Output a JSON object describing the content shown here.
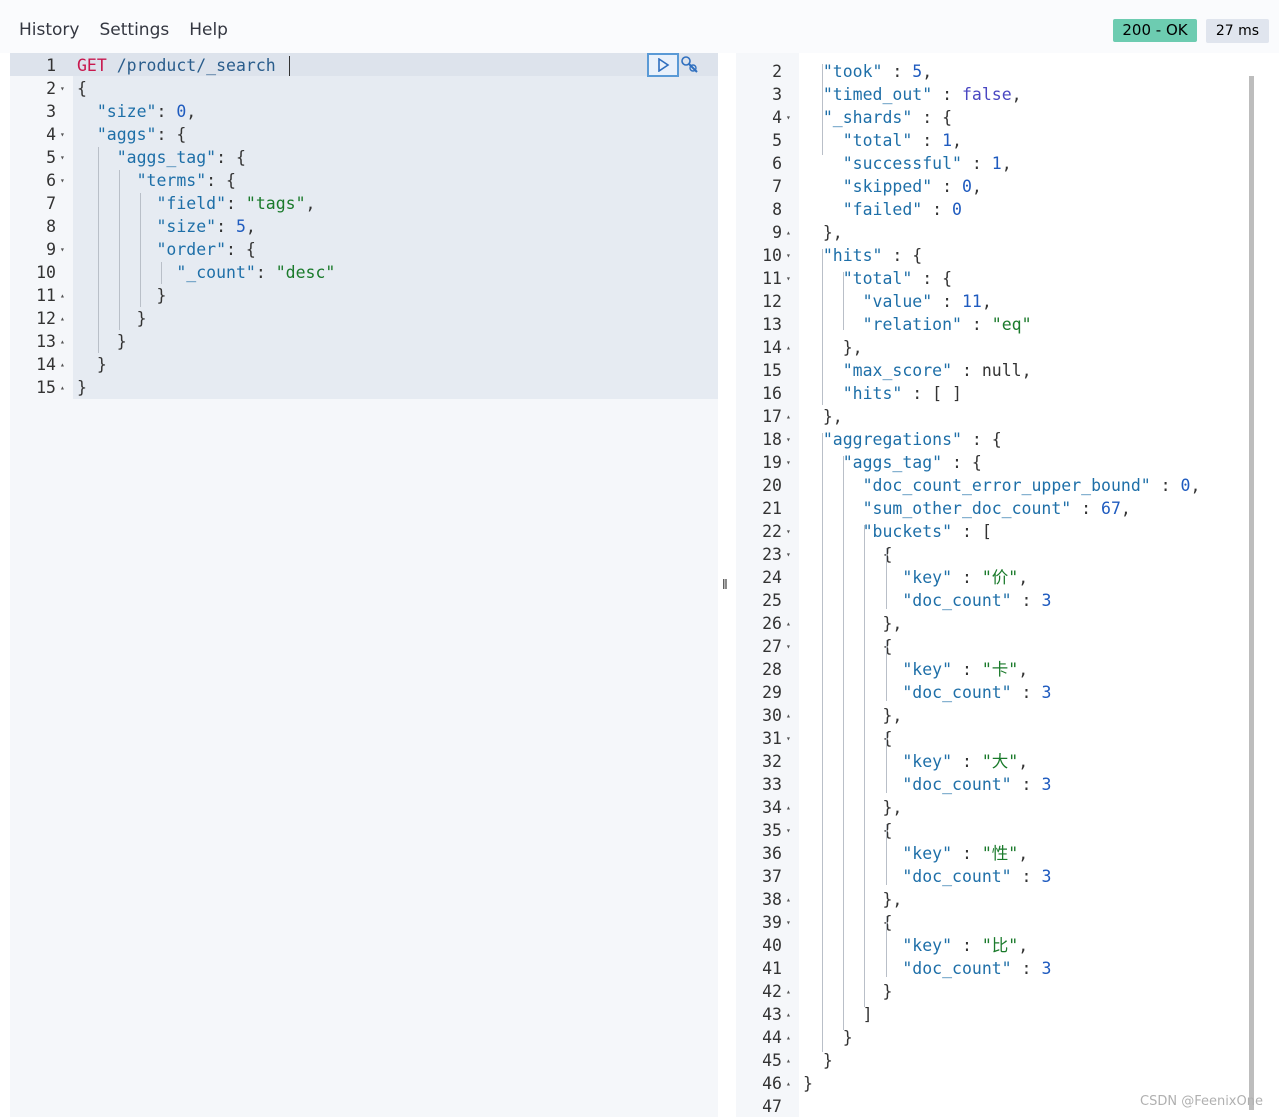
{
  "menu": {
    "history": "History",
    "settings": "Settings",
    "help": "Help"
  },
  "status": {
    "code": "200 - OK",
    "time": "27 ms"
  },
  "watermark": "CSDN @FeenixOne",
  "request": {
    "method": "GET",
    "path": "/product/_search",
    "lines": [
      {
        "n": "1",
        "fold": ""
      },
      {
        "n": "2",
        "fold": "▾"
      },
      {
        "n": "3",
        "fold": ""
      },
      {
        "n": "4",
        "fold": "▾"
      },
      {
        "n": "5",
        "fold": "▾"
      },
      {
        "n": "6",
        "fold": "▾"
      },
      {
        "n": "7",
        "fold": ""
      },
      {
        "n": "8",
        "fold": ""
      },
      {
        "n": "9",
        "fold": "▾"
      },
      {
        "n": "10",
        "fold": ""
      },
      {
        "n": "11",
        "fold": "▴"
      },
      {
        "n": "12",
        "fold": "▴"
      },
      {
        "n": "13",
        "fold": "▴"
      },
      {
        "n": "14",
        "fold": "▴"
      },
      {
        "n": "15",
        "fold": "▴"
      }
    ],
    "code": [
      [
        {
          "t": "GET",
          "c": "m"
        },
        {
          "t": " ",
          "c": "p"
        },
        {
          "t": "/product/_search",
          "c": "u"
        }
      ],
      [
        {
          "t": "{",
          "c": "p"
        }
      ],
      [
        {
          "t": "  ",
          "c": "p"
        },
        {
          "t": "\"size\"",
          "c": "k"
        },
        {
          "t": ": ",
          "c": "p"
        },
        {
          "t": "0",
          "c": "n"
        },
        {
          "t": ",",
          "c": "p"
        }
      ],
      [
        {
          "t": "  ",
          "c": "p"
        },
        {
          "t": "\"aggs\"",
          "c": "k"
        },
        {
          "t": ": {",
          "c": "p"
        }
      ],
      [
        {
          "t": "    ",
          "c": "p"
        },
        {
          "t": "\"aggs_tag\"",
          "c": "k"
        },
        {
          "t": ": {",
          "c": "p"
        }
      ],
      [
        {
          "t": "      ",
          "c": "p"
        },
        {
          "t": "\"terms\"",
          "c": "k"
        },
        {
          "t": ": {",
          "c": "p"
        }
      ],
      [
        {
          "t": "        ",
          "c": "p"
        },
        {
          "t": "\"field\"",
          "c": "k"
        },
        {
          "t": ": ",
          "c": "p"
        },
        {
          "t": "\"tags\"",
          "c": "s"
        },
        {
          "t": ",",
          "c": "p"
        }
      ],
      [
        {
          "t": "        ",
          "c": "p"
        },
        {
          "t": "\"size\"",
          "c": "k"
        },
        {
          "t": ": ",
          "c": "p"
        },
        {
          "t": "5",
          "c": "n"
        },
        {
          "t": ",",
          "c": "p"
        }
      ],
      [
        {
          "t": "        ",
          "c": "p"
        },
        {
          "t": "\"order\"",
          "c": "k"
        },
        {
          "t": ": {",
          "c": "p"
        }
      ],
      [
        {
          "t": "          ",
          "c": "p"
        },
        {
          "t": "\"_count\"",
          "c": "k"
        },
        {
          "t": ": ",
          "c": "p"
        },
        {
          "t": "\"desc\"",
          "c": "s"
        }
      ],
      [
        {
          "t": "        }",
          "c": "p"
        }
      ],
      [
        {
          "t": "      }",
          "c": "p"
        }
      ],
      [
        {
          "t": "    }",
          "c": "p"
        }
      ],
      [
        {
          "t": "  }",
          "c": "p"
        }
      ],
      [
        {
          "t": "}",
          "c": "p"
        }
      ]
    ]
  },
  "response": {
    "lines": [
      {
        "n": "2",
        "fold": ""
      },
      {
        "n": "3",
        "fold": ""
      },
      {
        "n": "4",
        "fold": "▾"
      },
      {
        "n": "5",
        "fold": ""
      },
      {
        "n": "6",
        "fold": ""
      },
      {
        "n": "7",
        "fold": ""
      },
      {
        "n": "8",
        "fold": ""
      },
      {
        "n": "9",
        "fold": "▴"
      },
      {
        "n": "10",
        "fold": "▾"
      },
      {
        "n": "11",
        "fold": "▾"
      },
      {
        "n": "12",
        "fold": ""
      },
      {
        "n": "13",
        "fold": ""
      },
      {
        "n": "14",
        "fold": "▴"
      },
      {
        "n": "15",
        "fold": ""
      },
      {
        "n": "16",
        "fold": ""
      },
      {
        "n": "17",
        "fold": "▴"
      },
      {
        "n": "18",
        "fold": "▾"
      },
      {
        "n": "19",
        "fold": "▾"
      },
      {
        "n": "20",
        "fold": ""
      },
      {
        "n": "21",
        "fold": ""
      },
      {
        "n": "22",
        "fold": "▾"
      },
      {
        "n": "23",
        "fold": "▾"
      },
      {
        "n": "24",
        "fold": ""
      },
      {
        "n": "25",
        "fold": ""
      },
      {
        "n": "26",
        "fold": "▴"
      },
      {
        "n": "27",
        "fold": "▾"
      },
      {
        "n": "28",
        "fold": ""
      },
      {
        "n": "29",
        "fold": ""
      },
      {
        "n": "30",
        "fold": "▴"
      },
      {
        "n": "31",
        "fold": "▾"
      },
      {
        "n": "32",
        "fold": ""
      },
      {
        "n": "33",
        "fold": ""
      },
      {
        "n": "34",
        "fold": "▴"
      },
      {
        "n": "35",
        "fold": "▾"
      },
      {
        "n": "36",
        "fold": ""
      },
      {
        "n": "37",
        "fold": ""
      },
      {
        "n": "38",
        "fold": "▴"
      },
      {
        "n": "39",
        "fold": "▾"
      },
      {
        "n": "40",
        "fold": ""
      },
      {
        "n": "41",
        "fold": ""
      },
      {
        "n": "42",
        "fold": "▴"
      },
      {
        "n": "43",
        "fold": "▴"
      },
      {
        "n": "44",
        "fold": "▴"
      },
      {
        "n": "45",
        "fold": "▴"
      },
      {
        "n": "46",
        "fold": "▴"
      },
      {
        "n": "47",
        "fold": ""
      }
    ],
    "code": [
      [
        {
          "t": "  ",
          "c": "p"
        },
        {
          "t": "\"took\"",
          "c": "k"
        },
        {
          "t": " : ",
          "c": "p"
        },
        {
          "t": "5",
          "c": "n"
        },
        {
          "t": ",",
          "c": "p"
        }
      ],
      [
        {
          "t": "  ",
          "c": "p"
        },
        {
          "t": "\"timed_out\"",
          "c": "k"
        },
        {
          "t": " : ",
          "c": "p"
        },
        {
          "t": "false",
          "c": "b"
        },
        {
          "t": ",",
          "c": "p"
        }
      ],
      [
        {
          "t": "  ",
          "c": "p"
        },
        {
          "t": "\"_shards\"",
          "c": "k"
        },
        {
          "t": " : {",
          "c": "p"
        }
      ],
      [
        {
          "t": "    ",
          "c": "p"
        },
        {
          "t": "\"total\"",
          "c": "k"
        },
        {
          "t": " : ",
          "c": "p"
        },
        {
          "t": "1",
          "c": "n"
        },
        {
          "t": ",",
          "c": "p"
        }
      ],
      [
        {
          "t": "    ",
          "c": "p"
        },
        {
          "t": "\"successful\"",
          "c": "k"
        },
        {
          "t": " : ",
          "c": "p"
        },
        {
          "t": "1",
          "c": "n"
        },
        {
          "t": ",",
          "c": "p"
        }
      ],
      [
        {
          "t": "    ",
          "c": "p"
        },
        {
          "t": "\"skipped\"",
          "c": "k"
        },
        {
          "t": " : ",
          "c": "p"
        },
        {
          "t": "0",
          "c": "n"
        },
        {
          "t": ",",
          "c": "p"
        }
      ],
      [
        {
          "t": "    ",
          "c": "p"
        },
        {
          "t": "\"failed\"",
          "c": "k"
        },
        {
          "t": " : ",
          "c": "p"
        },
        {
          "t": "0",
          "c": "n"
        }
      ],
      [
        {
          "t": "  },",
          "c": "p"
        }
      ],
      [
        {
          "t": "  ",
          "c": "p"
        },
        {
          "t": "\"hits\"",
          "c": "k"
        },
        {
          "t": " : {",
          "c": "p"
        }
      ],
      [
        {
          "t": "    ",
          "c": "p"
        },
        {
          "t": "\"total\"",
          "c": "k"
        },
        {
          "t": " : {",
          "c": "p"
        }
      ],
      [
        {
          "t": "      ",
          "c": "p"
        },
        {
          "t": "\"value\"",
          "c": "k"
        },
        {
          "t": " : ",
          "c": "p"
        },
        {
          "t": "11",
          "c": "n"
        },
        {
          "t": ",",
          "c": "p"
        }
      ],
      [
        {
          "t": "      ",
          "c": "p"
        },
        {
          "t": "\"relation\"",
          "c": "k"
        },
        {
          "t": " : ",
          "c": "p"
        },
        {
          "t": "\"eq\"",
          "c": "s"
        }
      ],
      [
        {
          "t": "    },",
          "c": "p"
        }
      ],
      [
        {
          "t": "    ",
          "c": "p"
        },
        {
          "t": "\"max_score\"",
          "c": "k"
        },
        {
          "t": " : null,",
          "c": "p"
        }
      ],
      [
        {
          "t": "    ",
          "c": "p"
        },
        {
          "t": "\"hits\"",
          "c": "k"
        },
        {
          "t": " : [ ]",
          "c": "p"
        }
      ],
      [
        {
          "t": "  },",
          "c": "p"
        }
      ],
      [
        {
          "t": "  ",
          "c": "p"
        },
        {
          "t": "\"aggregations\"",
          "c": "k"
        },
        {
          "t": " : {",
          "c": "p"
        }
      ],
      [
        {
          "t": "    ",
          "c": "p"
        },
        {
          "t": "\"aggs_tag\"",
          "c": "k"
        },
        {
          "t": " : {",
          "c": "p"
        }
      ],
      [
        {
          "t": "      ",
          "c": "p"
        },
        {
          "t": "\"doc_count_error_upper_bound\"",
          "c": "k"
        },
        {
          "t": " : ",
          "c": "p"
        },
        {
          "t": "0",
          "c": "n"
        },
        {
          "t": ",",
          "c": "p"
        }
      ],
      [
        {
          "t": "      ",
          "c": "p"
        },
        {
          "t": "\"sum_other_doc_count\"",
          "c": "k"
        },
        {
          "t": " : ",
          "c": "p"
        },
        {
          "t": "67",
          "c": "n"
        },
        {
          "t": ",",
          "c": "p"
        }
      ],
      [
        {
          "t": "      ",
          "c": "p"
        },
        {
          "t": "\"buckets\"",
          "c": "k"
        },
        {
          "t": " : [",
          "c": "p"
        }
      ],
      [
        {
          "t": "        {",
          "c": "p"
        }
      ],
      [
        {
          "t": "          ",
          "c": "p"
        },
        {
          "t": "\"key\"",
          "c": "k"
        },
        {
          "t": " : ",
          "c": "p"
        },
        {
          "t": "\"价\"",
          "c": "s"
        },
        {
          "t": ",",
          "c": "p"
        }
      ],
      [
        {
          "t": "          ",
          "c": "p"
        },
        {
          "t": "\"doc_count\"",
          "c": "k"
        },
        {
          "t": " : ",
          "c": "p"
        },
        {
          "t": "3",
          "c": "n"
        }
      ],
      [
        {
          "t": "        },",
          "c": "p"
        }
      ],
      [
        {
          "t": "        {",
          "c": "p"
        }
      ],
      [
        {
          "t": "          ",
          "c": "p"
        },
        {
          "t": "\"key\"",
          "c": "k"
        },
        {
          "t": " : ",
          "c": "p"
        },
        {
          "t": "\"卡\"",
          "c": "s"
        },
        {
          "t": ",",
          "c": "p"
        }
      ],
      [
        {
          "t": "          ",
          "c": "p"
        },
        {
          "t": "\"doc_count\"",
          "c": "k"
        },
        {
          "t": " : ",
          "c": "p"
        },
        {
          "t": "3",
          "c": "n"
        }
      ],
      [
        {
          "t": "        },",
          "c": "p"
        }
      ],
      [
        {
          "t": "        {",
          "c": "p"
        }
      ],
      [
        {
          "t": "          ",
          "c": "p"
        },
        {
          "t": "\"key\"",
          "c": "k"
        },
        {
          "t": " : ",
          "c": "p"
        },
        {
          "t": "\"大\"",
          "c": "s"
        },
        {
          "t": ",",
          "c": "p"
        }
      ],
      [
        {
          "t": "          ",
          "c": "p"
        },
        {
          "t": "\"doc_count\"",
          "c": "k"
        },
        {
          "t": " : ",
          "c": "p"
        },
        {
          "t": "3",
          "c": "n"
        }
      ],
      [
        {
          "t": "        },",
          "c": "p"
        }
      ],
      [
        {
          "t": "        {",
          "c": "p"
        }
      ],
      [
        {
          "t": "          ",
          "c": "p"
        },
        {
          "t": "\"key\"",
          "c": "k"
        },
        {
          "t": " : ",
          "c": "p"
        },
        {
          "t": "\"性\"",
          "c": "s"
        },
        {
          "t": ",",
          "c": "p"
        }
      ],
      [
        {
          "t": "          ",
          "c": "p"
        },
        {
          "t": "\"doc_count\"",
          "c": "k"
        },
        {
          "t": " : ",
          "c": "p"
        },
        {
          "t": "3",
          "c": "n"
        }
      ],
      [
        {
          "t": "        },",
          "c": "p"
        }
      ],
      [
        {
          "t": "        {",
          "c": "p"
        }
      ],
      [
        {
          "t": "          ",
          "c": "p"
        },
        {
          "t": "\"key\"",
          "c": "k"
        },
        {
          "t": " : ",
          "c": "p"
        },
        {
          "t": "\"比\"",
          "c": "s"
        },
        {
          "t": ",",
          "c": "p"
        }
      ],
      [
        {
          "t": "          ",
          "c": "p"
        },
        {
          "t": "\"doc_count\"",
          "c": "k"
        },
        {
          "t": " : ",
          "c": "p"
        },
        {
          "t": "3",
          "c": "n"
        }
      ],
      [
        {
          "t": "        }",
          "c": "p"
        }
      ],
      [
        {
          "t": "      ]",
          "c": "p"
        }
      ],
      [
        {
          "t": "    }",
          "c": "p"
        }
      ],
      [
        {
          "t": "  }",
          "c": "p"
        }
      ],
      [
        {
          "t": "}",
          "c": "p"
        }
      ],
      [
        {
          "t": "",
          "c": "p"
        }
      ]
    ]
  },
  "icons": {
    "run": "play-icon",
    "settings": "wrench-icon"
  }
}
